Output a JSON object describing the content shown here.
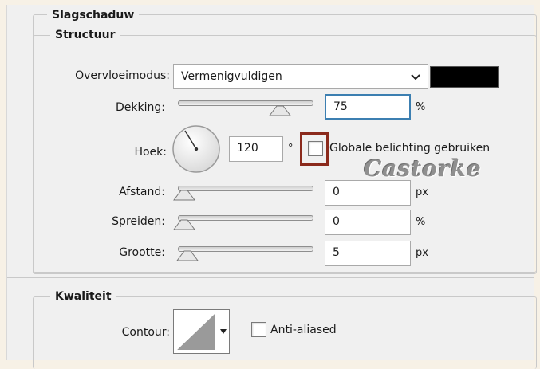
{
  "dropShadow": {
    "title": "Slagschaduw",
    "structure": {
      "title": "Structuur",
      "blendMode": {
        "label": "Overvloeimodus:",
        "value": "Vermenigvuldigen",
        "color": "#000000"
      },
      "opacity": {
        "label": "Dekking:",
        "value": "75",
        "unit": "%",
        "level": 0.75
      },
      "angle": {
        "label": "Hoek:",
        "value": "120",
        "unit": "°"
      },
      "globalLight": {
        "label": "Globale belichting gebruiken",
        "checked": false
      },
      "distance": {
        "label": "Afstand:",
        "value": "0",
        "unit": "px"
      },
      "spread": {
        "label": "Spreiden:",
        "value": "0",
        "unit": "%"
      },
      "size": {
        "label": "Grootte:",
        "value": "5",
        "unit": "px"
      }
    },
    "quality": {
      "title": "Kwaliteit",
      "contour": {
        "label": "Contour:"
      },
      "antiAliased": {
        "label": "Anti-aliased",
        "checked": false
      }
    }
  },
  "watermark": "Castorke",
  "colors": {
    "focusBorder": "#3c7fb1",
    "highlightBox": "#8b2a1c"
  }
}
